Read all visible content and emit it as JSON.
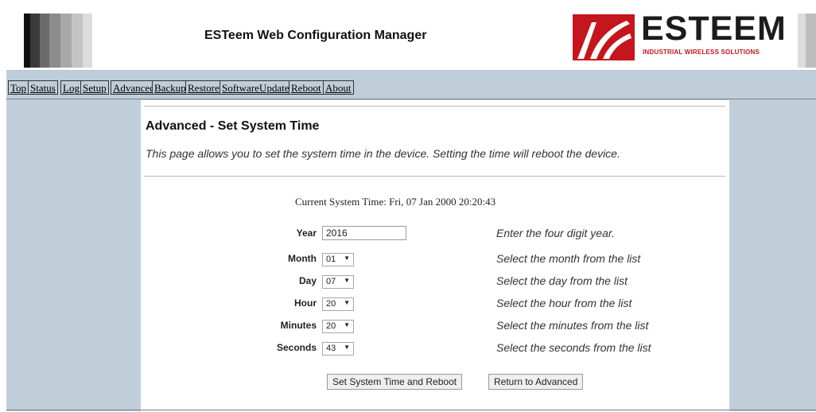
{
  "header": {
    "title": "ESTeem Web Configuration Manager",
    "logo_word": "ESTEEM",
    "logo_tagline": "INDUSTRIAL WIRELESS SOLUTIONS"
  },
  "nav": {
    "tabs": [
      {
        "label": "Top"
      },
      {
        "label": "Status"
      },
      {
        "label": "Log"
      },
      {
        "label": "Setup"
      },
      {
        "label": "Advanced"
      },
      {
        "label": "Backup"
      },
      {
        "label": "Restore"
      },
      {
        "label": "SoftwareUpdate"
      },
      {
        "label": "Reboot"
      },
      {
        "label": "About"
      }
    ]
  },
  "page": {
    "title": "Advanced - Set System Time",
    "description": "This page allows you to set the system time in the device. Setting the time will reboot the device.",
    "current_time_label": "Current System Time:",
    "current_time_value": "Fri, 07 Jan 2000 20:20:43"
  },
  "form": {
    "year": {
      "label": "Year",
      "value": "2016",
      "hint": "Enter the four digit year."
    },
    "month": {
      "label": "Month",
      "value": "01",
      "hint": "Select the month from the list"
    },
    "day": {
      "label": "Day",
      "value": "07",
      "hint": "Select the day from the list"
    },
    "hour": {
      "label": "Hour",
      "value": "20",
      "hint": "Select the hour from the list"
    },
    "minutes": {
      "label": "Minutes",
      "value": "20",
      "hint": "Select the minutes from the list"
    },
    "seconds": {
      "label": "Seconds",
      "value": "43",
      "hint": "Select the seconds from the list"
    }
  },
  "buttons": {
    "set_time": "Set System Time and Reboot",
    "return": "Return to Advanced"
  },
  "colors": {
    "page_bg": "#c0ced9",
    "logo_red": "#c4161c",
    "nav_border": "#333333"
  }
}
